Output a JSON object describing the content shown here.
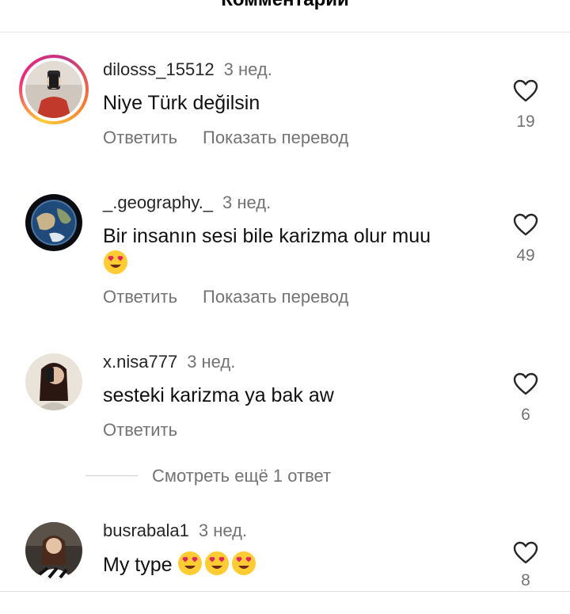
{
  "header": {
    "title": "Комментарии"
  },
  "comments": [
    {
      "username": "dilosss_15512",
      "time": "3 нед.",
      "text": "Niye Türk değilsin",
      "reply_label": "Ответить",
      "translate_label": "Показать перевод",
      "likes": "19"
    },
    {
      "username": "_.geography._",
      "time": "3 нед.",
      "text": "Bir insanın sesi bile karizma olur muu",
      "reply_label": "Ответить",
      "translate_label": "Показать перевод",
      "likes": "49"
    },
    {
      "username": "x.nisa777",
      "time": "3 нед.",
      "text": "sesteki karizma ya bak aw",
      "reply_label": "Ответить",
      "likes": "6"
    },
    {
      "username": "busrabala1",
      "time": "3 нед.",
      "text": "My type",
      "likes": "8"
    }
  ],
  "view_more": {
    "label": "Смотреть ещё 1 ответ"
  },
  "icons": {
    "like": "heart-outline-icon",
    "emoji": "heart-eyes-emoji"
  },
  "colors": {
    "muted": "#737373",
    "story_ring": "#ee2a7b",
    "emoji_face": "#ffcc33",
    "emoji_heart": "#e0245e"
  }
}
